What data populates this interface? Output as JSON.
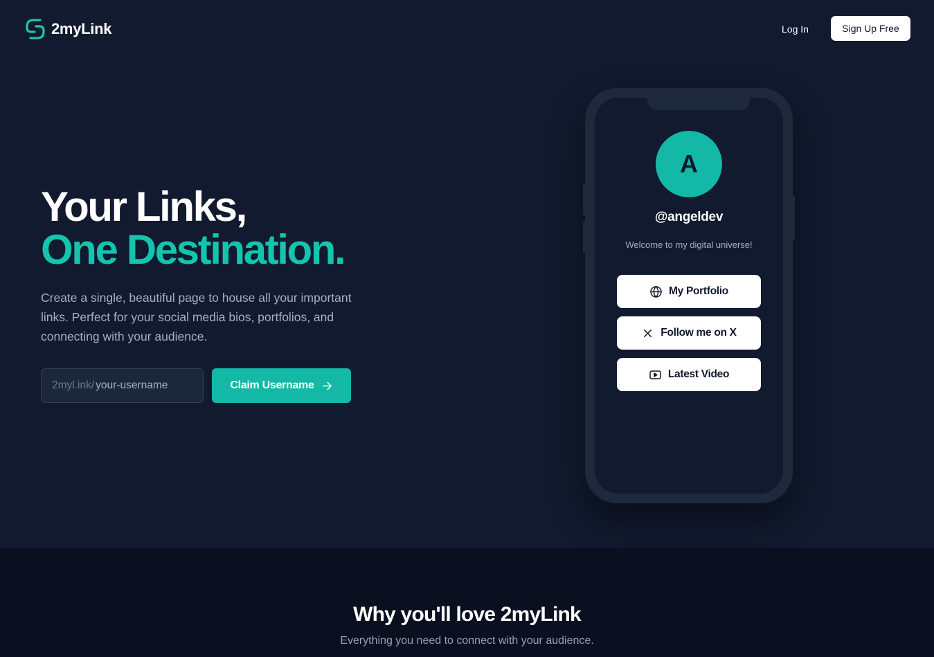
{
  "brand": {
    "name": "2myLink",
    "accent": "#14b8a6",
    "icon": "logo-icon"
  },
  "nav": {
    "login_label": "Log In",
    "signup_label": "Sign Up Free"
  },
  "hero": {
    "title_line1": "Your Links,",
    "title_line2": "One Destination.",
    "description": "Create a single, beautiful page to house all your important links. Perfect for your social media bios, portfolios, and connecting with your audience.",
    "claim": {
      "prefix": "2myl.ink/",
      "placeholder": "your-username",
      "button_label": "Claim Username",
      "button_icon": "arrow-right-icon"
    }
  },
  "phone_preview": {
    "avatar_initial": "A",
    "handle": "@angeldev",
    "bio": "Welcome to my digital universe!",
    "links": [
      {
        "label": "My Portfolio",
        "icon": "globe-icon"
      },
      {
        "label": "Follow me on X",
        "icon": "x-icon"
      },
      {
        "label": "Latest Video",
        "icon": "video-icon"
      }
    ]
  },
  "features": {
    "title": "Why you'll love 2myLink",
    "subtitle": "Everything you need to connect with your audience."
  }
}
